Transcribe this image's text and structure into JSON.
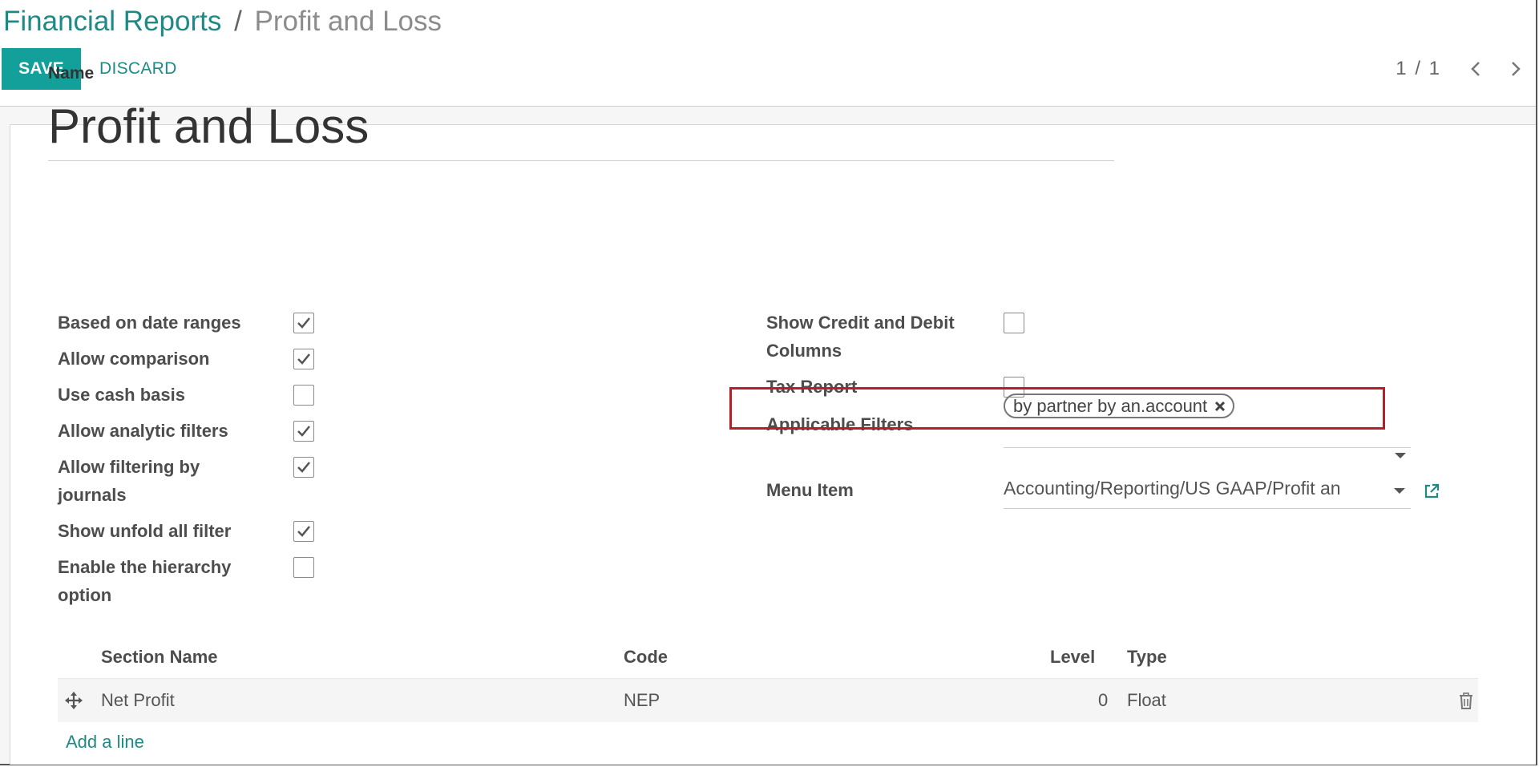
{
  "breadcrumb": {
    "parent": "Financial Reports",
    "separator": "/",
    "current": "Profit and Loss"
  },
  "toolbar": {
    "save_label": "SAVE",
    "discard_label": "DISCARD"
  },
  "pager": {
    "value": "1 / 1"
  },
  "form": {
    "name_label": "Name",
    "name_value": "Profit and Loss",
    "left_fields": [
      {
        "label": "Based on date ranges",
        "checked": true
      },
      {
        "label": "Allow comparison",
        "checked": true
      },
      {
        "label": "Use cash basis",
        "checked": false
      },
      {
        "label": "Allow analytic filters",
        "checked": true
      },
      {
        "label_line1": "Allow filtering by",
        "label_line2": "journals",
        "checked": true
      },
      {
        "label": "Show unfold all filter",
        "checked": true
      },
      {
        "label_line1": "Enable the hierarchy",
        "label_line2": "option",
        "checked": false
      }
    ],
    "right_fields": {
      "credit_debit_line1": "Show Credit and Debit",
      "credit_debit_line2": "Columns",
      "credit_debit_checked": false,
      "tax_report": "Tax Report",
      "tax_report_checked": false,
      "applicable_filters": "Applicable Filters",
      "filter_tag": "by partner by an.account",
      "menu_item": "Menu Item",
      "menu_item_value": "Accounting/Reporting/US GAAP/Profit an"
    }
  },
  "lines_table": {
    "headers": [
      "Section Name",
      "Code",
      "Level",
      "Type"
    ],
    "rows": [
      {
        "name": "Net Profit",
        "code": "NEP",
        "level": "0",
        "type": "Float"
      }
    ],
    "add_line": "Add a line"
  },
  "colors": {
    "primary": "#13a09a",
    "link": "#1e8a86",
    "highlight": "#b52026"
  }
}
